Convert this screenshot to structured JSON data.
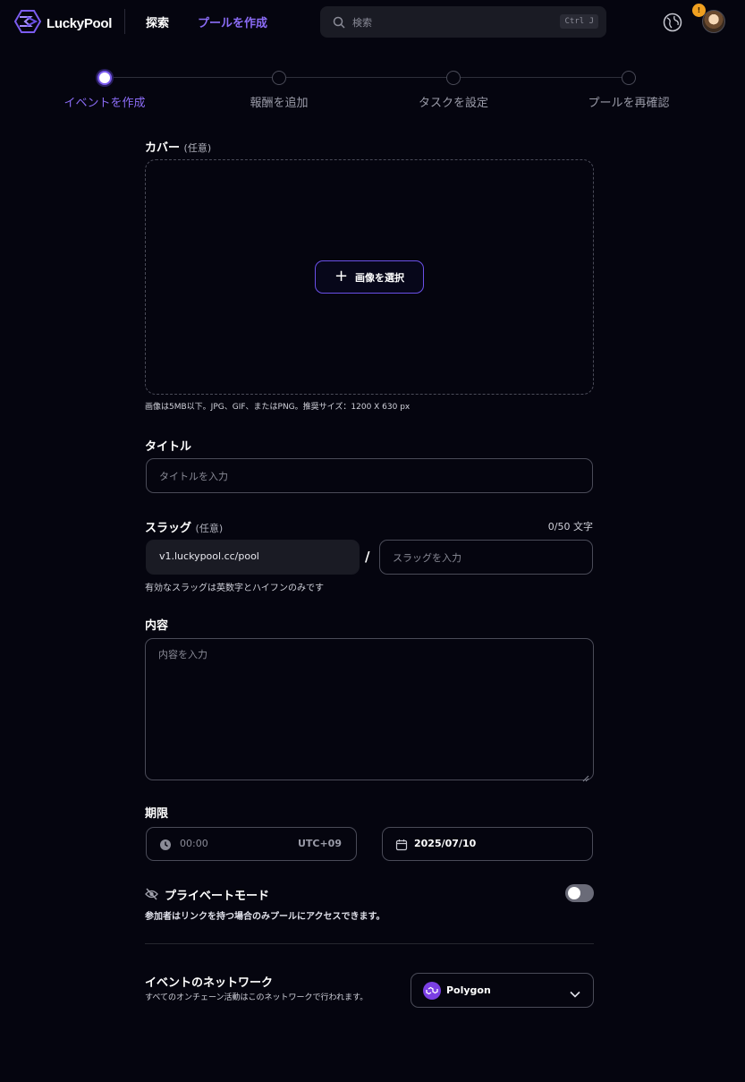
{
  "header": {
    "logo_text": "LuckyPool",
    "nav_explore": "探索",
    "nav_create_pool": "プールを作成",
    "search_placeholder": "検索",
    "search_shortcut": "Ctrl J",
    "notification_count": "!"
  },
  "stepper": {
    "steps": [
      {
        "label": "イベントを作成",
        "active": true
      },
      {
        "label": "報酬を追加",
        "active": false
      },
      {
        "label": "タスクを設定",
        "active": false
      },
      {
        "label": "プールを再確認",
        "active": false
      }
    ]
  },
  "form": {
    "cover": {
      "label": "カバー",
      "optional": "(任意)",
      "button_label": "画像を選択",
      "hint": "画像は5MB以下。JPG、GIF、またはPNG。推奨サイズ：1200 X 630 px"
    },
    "title": {
      "label": "タイトル",
      "placeholder": "タイトルを入力"
    },
    "slug": {
      "label": "スラッグ",
      "optional": "(任意)",
      "counter": "0/50 文字",
      "prefix": "v1.luckypool.cc/pool",
      "separator": "/",
      "placeholder": "スラッグを入力",
      "hint": "有効なスラッグは英数字とハイフンのみです"
    },
    "content": {
      "label": "内容",
      "placeholder": "内容を入力"
    },
    "deadline": {
      "label": "期限",
      "time_value": "00:00",
      "timezone": "UTC+09",
      "date_value": "2025/07/10"
    },
    "private_mode": {
      "label": "プライベートモード",
      "description": "参加者はリンクを持つ場合のみプールにアクセスできます。",
      "enabled": false
    },
    "network": {
      "label": "イベントのネットワーク",
      "description": "すべてのオンチェーン活動はこのネットワークで行われます。",
      "selected": "Polygon"
    }
  },
  "colors": {
    "accent": "#8b6cf6",
    "background": "#05050f",
    "polygon": "#7b3fe4"
  }
}
